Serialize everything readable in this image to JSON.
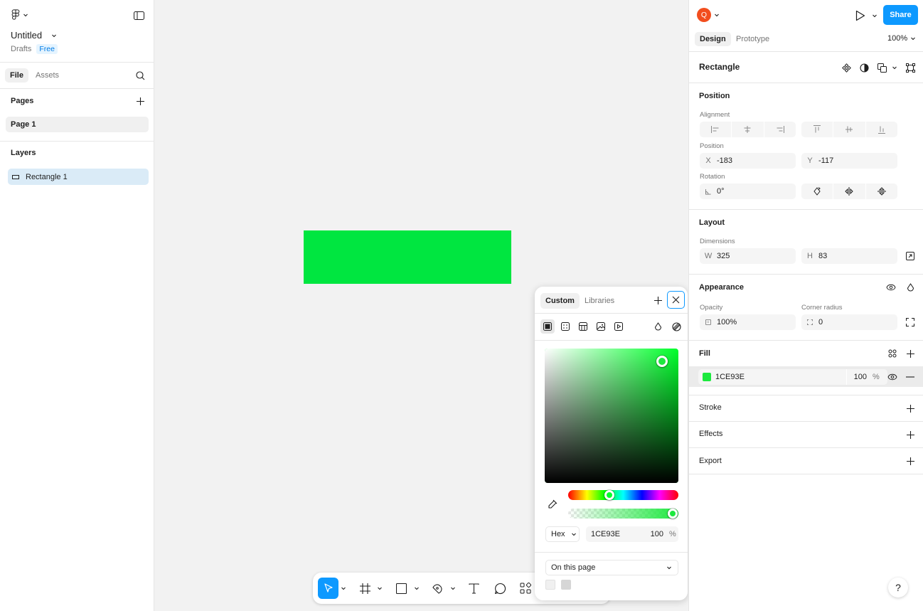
{
  "left_panel": {
    "file_name": "Untitled",
    "location": "Drafts",
    "plan_badge": "Free",
    "tabs": [
      {
        "label": "File",
        "active": true
      },
      {
        "label": "Assets",
        "active": false
      }
    ],
    "pages_title": "Pages",
    "pages": [
      {
        "label": "Page 1",
        "selected": true
      }
    ],
    "layers_title": "Layers",
    "layers": [
      {
        "label": "Rectangle 1",
        "selected": true
      }
    ]
  },
  "canvas": {
    "rectangle_fill": "#00e640"
  },
  "toolbar": {
    "tools": [
      "move-tool",
      "frame-tool",
      "rectangle-tool",
      "pen-tool",
      "text-tool",
      "comment-tool",
      "actions-tool"
    ],
    "selected_tool": "move-tool",
    "accent": "#0d99ff"
  },
  "color_picker": {
    "tabs": [
      {
        "label": "Custom",
        "active": true
      },
      {
        "label": "Libraries",
        "active": false
      }
    ],
    "fill_types": [
      "solid-fill-icon",
      "gradient-fill-icon",
      "pattern-fill-icon",
      "image-fill-icon",
      "video-fill-icon"
    ],
    "color_model": "Hex",
    "hex_value": "1CE93E",
    "alpha_value": "100",
    "alpha_unit": "%",
    "hue_fraction": 0.36,
    "swatch_source": "On this page",
    "swatches": [
      "#f0f0f0",
      "#d6d6d6"
    ]
  },
  "right_panel": {
    "avatar_letter": "Q",
    "avatar_color": "#f24e1e",
    "share_label": "Share",
    "tabs": [
      {
        "label": "Design",
        "active": true
      },
      {
        "label": "Prototype",
        "active": false
      }
    ],
    "zoom": "100%",
    "selection_name": "Rectangle",
    "position_section": {
      "title": "Position",
      "alignment_label": "Alignment",
      "position_label": "Position",
      "x_prefix": "X",
      "x": "-183",
      "y_prefix": "Y",
      "y": "-117",
      "rotation_label": "Rotation",
      "rotation": "0°"
    },
    "layout_section": {
      "title": "Layout",
      "dimensions_label": "Dimensions",
      "w_prefix": "W",
      "w": "325",
      "h_prefix": "H",
      "h": "83"
    },
    "appearance_section": {
      "title": "Appearance",
      "opacity_label": "Opacity",
      "opacity": "100%",
      "corner_label": "Corner radius",
      "corner": "0"
    },
    "fill_section": {
      "title": "Fill",
      "swatch_color": "#1ce93e",
      "hex": "1CE93E",
      "opacity": "100",
      "unit": "%"
    },
    "stroke_title": "Stroke",
    "effects_title": "Effects",
    "export_title": "Export",
    "help_label": "?"
  }
}
